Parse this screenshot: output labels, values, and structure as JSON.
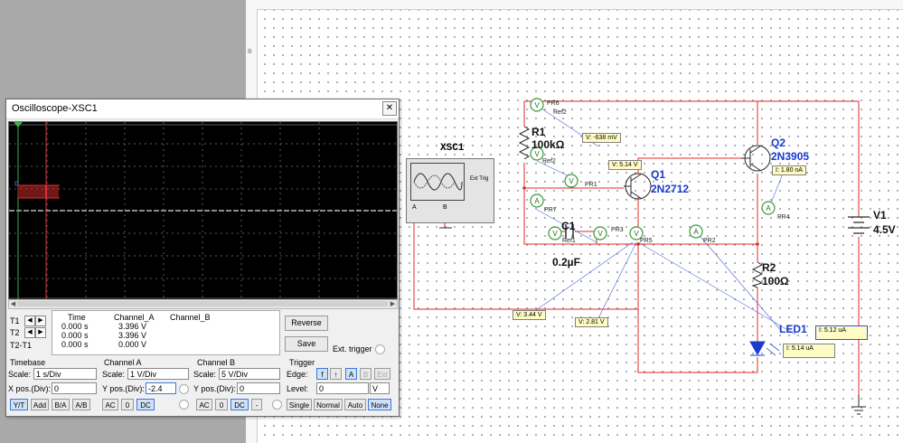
{
  "canvas": {
    "sheet_marker": "B",
    "scope_label": "XSC1",
    "scope_block": {
      "ext_trig": "Ext Trig",
      "a": "A",
      "b": "B"
    },
    "components": {
      "r1_name": "R1",
      "r1_value": "100kΩ",
      "r2_name": "R2",
      "r2_value": "100Ω",
      "c1_name": "C1",
      "c1_value": "0.2µF",
      "q1_name": "Q1",
      "q1_model": "2N2712",
      "q2_name": "Q2",
      "q2_model": "2N3905",
      "v1_name": "V1",
      "v1_value": "4.5V",
      "led1_name": "LED1"
    },
    "probes": [
      "PR1",
      "PR2",
      "PR3",
      "PR4",
      "PR5",
      "PR6",
      "PR7"
    ],
    "refs": [
      "Ref1",
      "Ref2",
      "Ref2"
    ],
    "readouts": {
      "v_minus": "V: -638 mV",
      "v_514": "V: 5.14 V",
      "i_180": "I: 1.80 nA",
      "v_344": "V: 3.44 V",
      "v_281": "V: 2.81 V",
      "i_512": "I: 5.12 uA",
      "i_514": "I: 5.14 uA"
    },
    "probe_icon_v": "V",
    "probe_icon_a": "A"
  },
  "oscilloscope": {
    "title": "Oscilloscope-XSC1",
    "close": "✕",
    "table": {
      "headers": [
        "Time",
        "Channel_A",
        "Channel_B"
      ],
      "rows": [
        {
          "label": "T1",
          "time": "0.000 s",
          "a": "3.396 V",
          "b": ""
        },
        {
          "label": "T2",
          "time": "0.000 s",
          "a": "3.396 V",
          "b": ""
        },
        {
          "label": "T2-T1",
          "time": "0.000 s",
          "a": "0.000 V",
          "b": ""
        }
      ]
    },
    "buttons": {
      "reverse": "Reverse",
      "save": "Save",
      "ext_trigger": "Ext. trigger"
    },
    "timebase": {
      "header": "Timebase",
      "scale_label": "Scale:",
      "scale": "1 s/Div",
      "xpos_label": "X pos.(Div):",
      "xpos": "0",
      "modes": [
        "Y/T",
        "Add",
        "B/A",
        "A/B"
      ]
    },
    "channel_a": {
      "header": "Channel A",
      "scale_label": "Scale:",
      "scale": "1 V/Div",
      "ypos_label": "Y pos.(Div):",
      "ypos": "-2.4",
      "coupling": [
        "AC",
        "0",
        "DC"
      ]
    },
    "channel_b": {
      "header": "Channel B",
      "scale_label": "Scale:",
      "scale": "5 V/Div",
      "ypos_label": "Y pos.(Div):",
      "ypos": "0",
      "coupling": [
        "AC",
        "0",
        "DC",
        "-"
      ]
    },
    "trigger": {
      "header": "Trigger",
      "edge_label": "Edge:",
      "edges": [
        "f",
        "↑",
        "A",
        "B",
        "Ext"
      ],
      "level_label": "Level:",
      "level": "0",
      "level_unit": "V",
      "modes": [
        "Single",
        "Normal",
        "Auto",
        "None"
      ]
    }
  },
  "colors": {
    "wire": "#e02828",
    "probe_wire": "#4a6ad8",
    "label_blue": "#1a3bd0",
    "scope_bg": "#000000",
    "trace_a": "#e03030"
  }
}
